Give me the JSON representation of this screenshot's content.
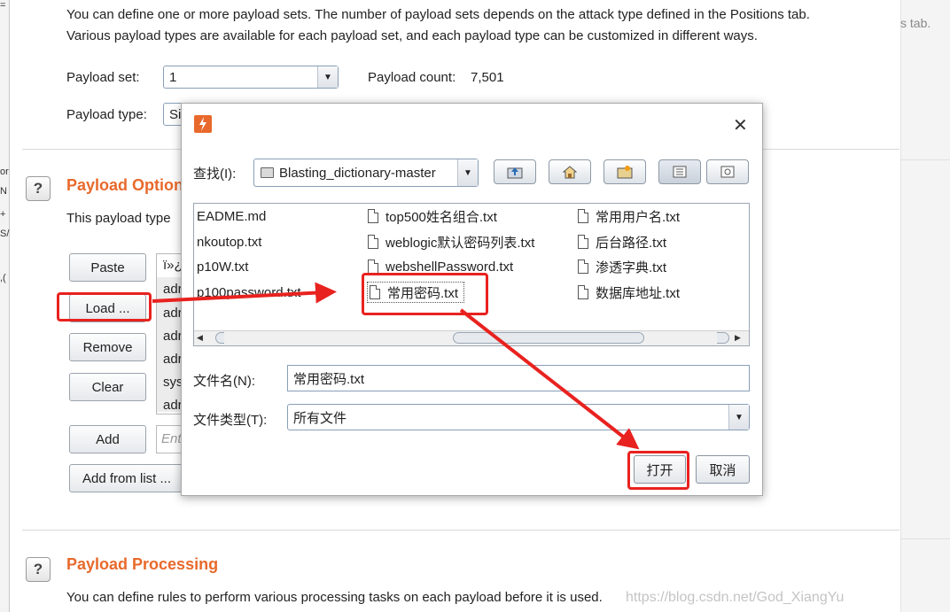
{
  "left_strip": {
    "chars": [
      "=",
      "or",
      "N",
      "+",
      "S/",
      ",("
    ]
  },
  "right_panel": {
    "text": "s tab."
  },
  "intro": {
    "line1": "You can define one or more payload sets. The number of payload sets depends on the attack type defined in the Positions tab.",
    "line2": "Various payload types are available for each payload set, and each payload type can be customized in different ways."
  },
  "payload_set": {
    "label": "Payload set:",
    "value": "1",
    "count_label": "Payload count:",
    "count_value": "7,501"
  },
  "payload_type": {
    "label": "Payload type:",
    "value": "Si"
  },
  "options": {
    "help": "?",
    "title": "Payload Option",
    "description": "This payload type",
    "buttons": {
      "paste": "Paste",
      "load": "Load ...",
      "remove": "Remove",
      "clear": "Clear",
      "add": "Add",
      "add_from_list": "Add from list ..."
    },
    "list_items": [
      "ï»¿",
      "adr",
      "adr",
      "adr",
      "adr",
      "sys",
      "adr"
    ],
    "add_placeholder": "Ent"
  },
  "processing": {
    "help": "?",
    "title": "Payload Processing",
    "description": "You can define rules to perform various processing tasks on each payload before it is used."
  },
  "dialog": {
    "close_glyph": "✕",
    "lookin_label": "查找(I):",
    "folder": "Blasting_dictionary-master",
    "files": [
      {
        "name": "EADME.md"
      },
      {
        "name": "top500姓名组合.txt"
      },
      {
        "name": "常用用户名.txt"
      },
      {
        "name": "nkoutop.txt"
      },
      {
        "name": "weblogic默认密码列表.txt"
      },
      {
        "name": "后台路径.txt"
      },
      {
        "name": "p10W.txt"
      },
      {
        "name": "webshellPassword.txt"
      },
      {
        "name": "渗透字典.txt"
      },
      {
        "name": "p100password.txt"
      },
      {
        "name": "常用密码.txt"
      },
      {
        "name": "数据库地址.txt"
      }
    ],
    "filename_label": "文件名(N):",
    "filename_value": "常用密码.txt",
    "filetype_label": "文件类型(T):",
    "filetype_value": "所有文件",
    "open_button": "打开",
    "cancel_button": "取消"
  },
  "annotation_color": "#e8221f",
  "accent_color": "#e8692b",
  "watermark": "https://blog.csdn.net/God_XiangYu"
}
